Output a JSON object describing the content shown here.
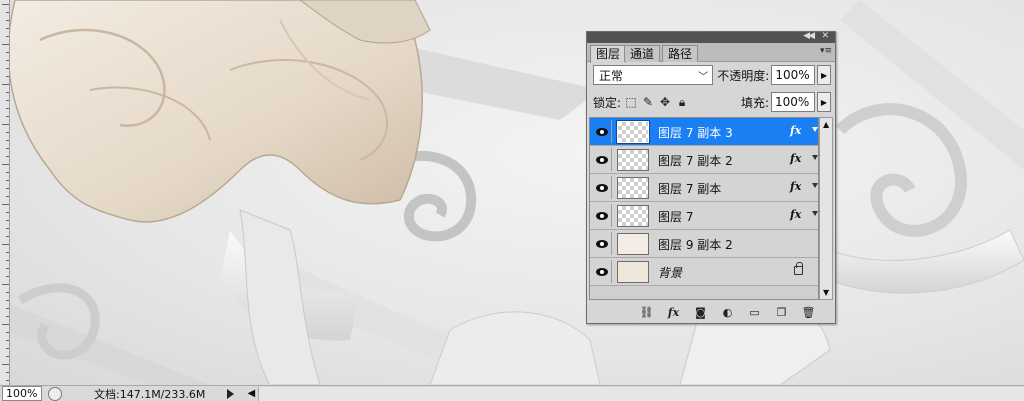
{
  "panel": {
    "tabs": [
      {
        "label": "图层",
        "active": true
      },
      {
        "label": "通道",
        "active": false
      },
      {
        "label": "路径",
        "active": false
      }
    ],
    "blend_mode": "正常",
    "opacity_label": "不透明度:",
    "opacity_value": "100%",
    "lock_label": "锁定:",
    "fill_label": "填充:",
    "fill_value": "100%",
    "layers": [
      {
        "name": "图层 7 副本 3",
        "selected": true,
        "fx": "fx",
        "thumbnail": "transparent"
      },
      {
        "name": "图层 7 副本 2",
        "selected": false,
        "fx": "fx",
        "thumbnail": "transparent"
      },
      {
        "name": "图层 7 副本",
        "selected": false,
        "fx": "fx",
        "thumbnail": "transparent"
      },
      {
        "name": "图层 7",
        "selected": false,
        "fx": "fx",
        "thumbnail": "transparent"
      },
      {
        "name": "图层 9 副本 2",
        "selected": false,
        "fx": null,
        "thumbnail": "content"
      },
      {
        "name": "背景",
        "selected": false,
        "fx": null,
        "locked": true,
        "thumbnail": "cream"
      }
    ],
    "footer_icons": [
      "link-icon",
      "fx-icon",
      "mask-icon",
      "adjustment-icon",
      "group-icon",
      "new-layer-icon",
      "trash-icon"
    ],
    "footer_fx_label": "fx"
  },
  "statusbar": {
    "zoom": "100%",
    "doc_info": "文档:147.1M/233.6M"
  },
  "colors": {
    "selection": "#1a7ff2",
    "panel_bg": "#d6d6d6",
    "titlebar": "#535353"
  }
}
